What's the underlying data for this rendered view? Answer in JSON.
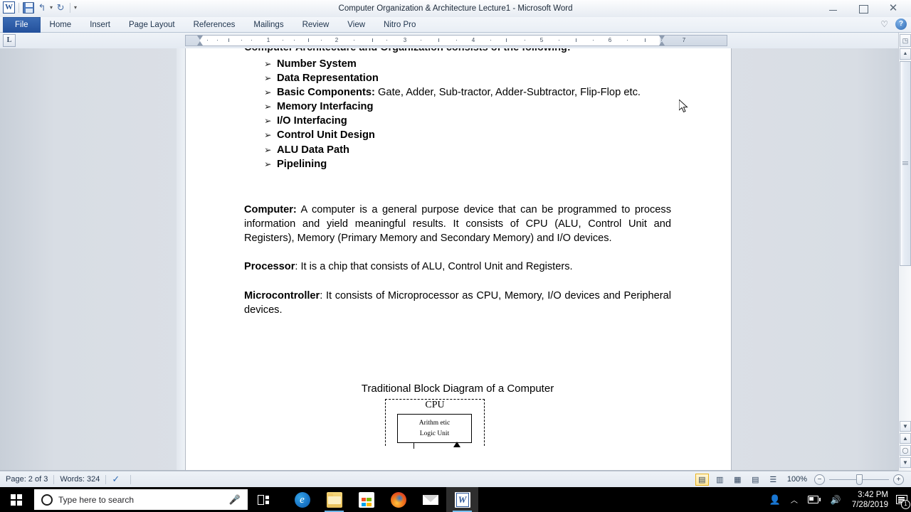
{
  "window": {
    "title": "Computer Organization & Architecture Lecture1  -  Microsoft Word",
    "quick_access": {
      "word_logo": "W",
      "save_icon": "save-icon",
      "undo_icon": "↰",
      "redo_icon": "↻",
      "customize_icon": "▾"
    },
    "controls": {
      "minimize": "minimize-button",
      "maximize": "maximize-button",
      "close": "✕"
    },
    "ribbon_right": {
      "heart": "♡",
      "help": "?"
    }
  },
  "ribbon": {
    "tabs": [
      {
        "label": "File",
        "active": true
      },
      {
        "label": "Home",
        "active": false
      },
      {
        "label": "Insert",
        "active": false
      },
      {
        "label": "Page Layout",
        "active": false
      },
      {
        "label": "References",
        "active": false
      },
      {
        "label": "Mailings",
        "active": false
      },
      {
        "label": "Review",
        "active": false
      },
      {
        "label": "View",
        "active": false
      },
      {
        "label": "Nitro Pro",
        "active": false
      }
    ]
  },
  "ruler": {
    "tab_selector_glyph": "L",
    "marks": [
      "1",
      "1",
      "2",
      "1",
      "3",
      "1",
      "4",
      "1",
      "5",
      "1",
      "6",
      "1",
      "7"
    ]
  },
  "document": {
    "clipped_heading": "Computer Architecture and Organization consists of the following:",
    "bullets": [
      {
        "arrow": "➢",
        "bold": "Number System",
        "normal": ""
      },
      {
        "arrow": "➢",
        "bold": "Data Representation",
        "normal": ""
      },
      {
        "arrow": "➢",
        "bold": "Basic Components:",
        "normal": " Gate, Adder, Sub-tractor, Adder-Subtractor, Flip-Flop etc."
      },
      {
        "arrow": "➢",
        "bold": "Memory Interfacing",
        "normal": ""
      },
      {
        "arrow": "➢",
        "bold": "I/O Interfacing",
        "normal": ""
      },
      {
        "arrow": "➢",
        "bold": "Control Unit Design",
        "normal": ""
      },
      {
        "arrow": "➢",
        "bold": "ALU Data Path",
        "normal": ""
      },
      {
        "arrow": "➢",
        "bold": "Pipelining",
        "normal": ""
      }
    ],
    "paragraphs": [
      {
        "term": "Computer:",
        "text": " A computer is a general purpose device that can be programmed to process information and yield meaningful results. It consists of CPU (ALU, Control Unit and Registers), Memory (Primary Memory and Secondary Memory) and I/O devices."
      },
      {
        "term": "Processor",
        "text": ": It is a chip that consists of ALU, Control Unit and Registers."
      },
      {
        "term": "Microcontroller",
        "text": ": It consists of Microprocessor as CPU, Memory, I/O devices and Peripheral devices."
      }
    ],
    "figure": {
      "title": "Traditional Block Diagram of a Computer",
      "cpu_label": "CPU",
      "alu_line1": "Arithm etic",
      "alu_line2": "Logic Unit"
    }
  },
  "status_bar": {
    "page": "Page: 2 of 3",
    "words": "Words: 324",
    "proofing_icon": "proofing-errors-icon",
    "view_buttons": [
      {
        "name": "print-layout",
        "glyph": "▤",
        "active": true
      },
      {
        "name": "full-screen-reading",
        "glyph": "▥",
        "active": false
      },
      {
        "name": "web-layout",
        "glyph": "▦",
        "active": false
      },
      {
        "name": "outline",
        "glyph": "▤",
        "active": false
      },
      {
        "name": "draft",
        "glyph": "☰",
        "active": false
      }
    ],
    "zoom_level": "100%",
    "zoom_out": "−",
    "zoom_in": "+"
  },
  "taskbar": {
    "start": "windows-logo",
    "search_placeholder": "Type here to search",
    "mic_icon": "🎤",
    "task_view": "task-view-icon",
    "apps": [
      {
        "name": "edge",
        "label": "Microsoft Edge",
        "running": false,
        "active": false
      },
      {
        "name": "file-explorer",
        "label": "File Explorer",
        "running": true,
        "active": false
      },
      {
        "name": "store",
        "label": "Microsoft Store",
        "running": false,
        "active": false
      },
      {
        "name": "firefox",
        "label": "Mozilla Firefox",
        "running": false,
        "active": false
      },
      {
        "name": "mail",
        "label": "Mail",
        "running": false,
        "active": false
      },
      {
        "name": "word",
        "label": "Microsoft Word",
        "running": true,
        "active": true
      }
    ],
    "tray": {
      "people": "people-icon",
      "chevron": "︿",
      "battery": "battery-icon",
      "volume": "volume-icon",
      "time": "3:42 PM",
      "date": "7/28/2019",
      "notification_count": "1"
    }
  },
  "colors": {
    "file_tab": "#23509b",
    "accent": "#2a5699",
    "taskbar": "#000000",
    "active_view_border": "#e8b21e"
  }
}
